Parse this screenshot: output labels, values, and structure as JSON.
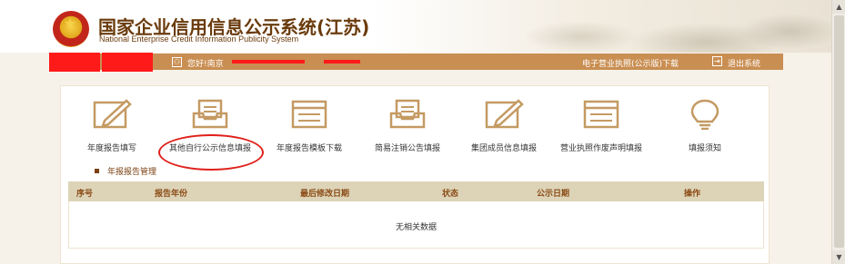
{
  "header": {
    "title": "国家企业信用信息公示系统(江苏)",
    "subtitle": "National Enterprise Credit Information Publicity System"
  },
  "userbar": {
    "greeting": "您好!南京",
    "license_link": "电子营业执照(公示版)下载",
    "exit_link": "退出系统",
    "user_icon": "user-icon",
    "exit_icon": "exit-icon"
  },
  "tiles": [
    {
      "label": "年度报告填写",
      "icon": "edit-icon"
    },
    {
      "label": "其他自行公示信息填报",
      "icon": "inbox-icon"
    },
    {
      "label": "年度报告模板下载",
      "icon": "template-icon"
    },
    {
      "label": "简易注销公告填报",
      "icon": "inbox-icon"
    },
    {
      "label": "集团成员信息填报",
      "icon": "edit-icon"
    },
    {
      "label": "营业执照作废声明填报",
      "icon": "template-icon"
    },
    {
      "label": "填报须知",
      "icon": "lightbulb-icon"
    }
  ],
  "section": {
    "title": "年报报告管理"
  },
  "table": {
    "columns": [
      "序号",
      "报告年份",
      "最后修改日期",
      "状态",
      "公示日期",
      "操作"
    ],
    "empty_text": "无相关数据"
  },
  "colors": {
    "accent_brown": "#c98e52",
    "title_brown": "#6a3b0c",
    "icon_tan": "#c49a63",
    "highlight_red": "#e0201a",
    "table_header": "#ddd4b8"
  }
}
